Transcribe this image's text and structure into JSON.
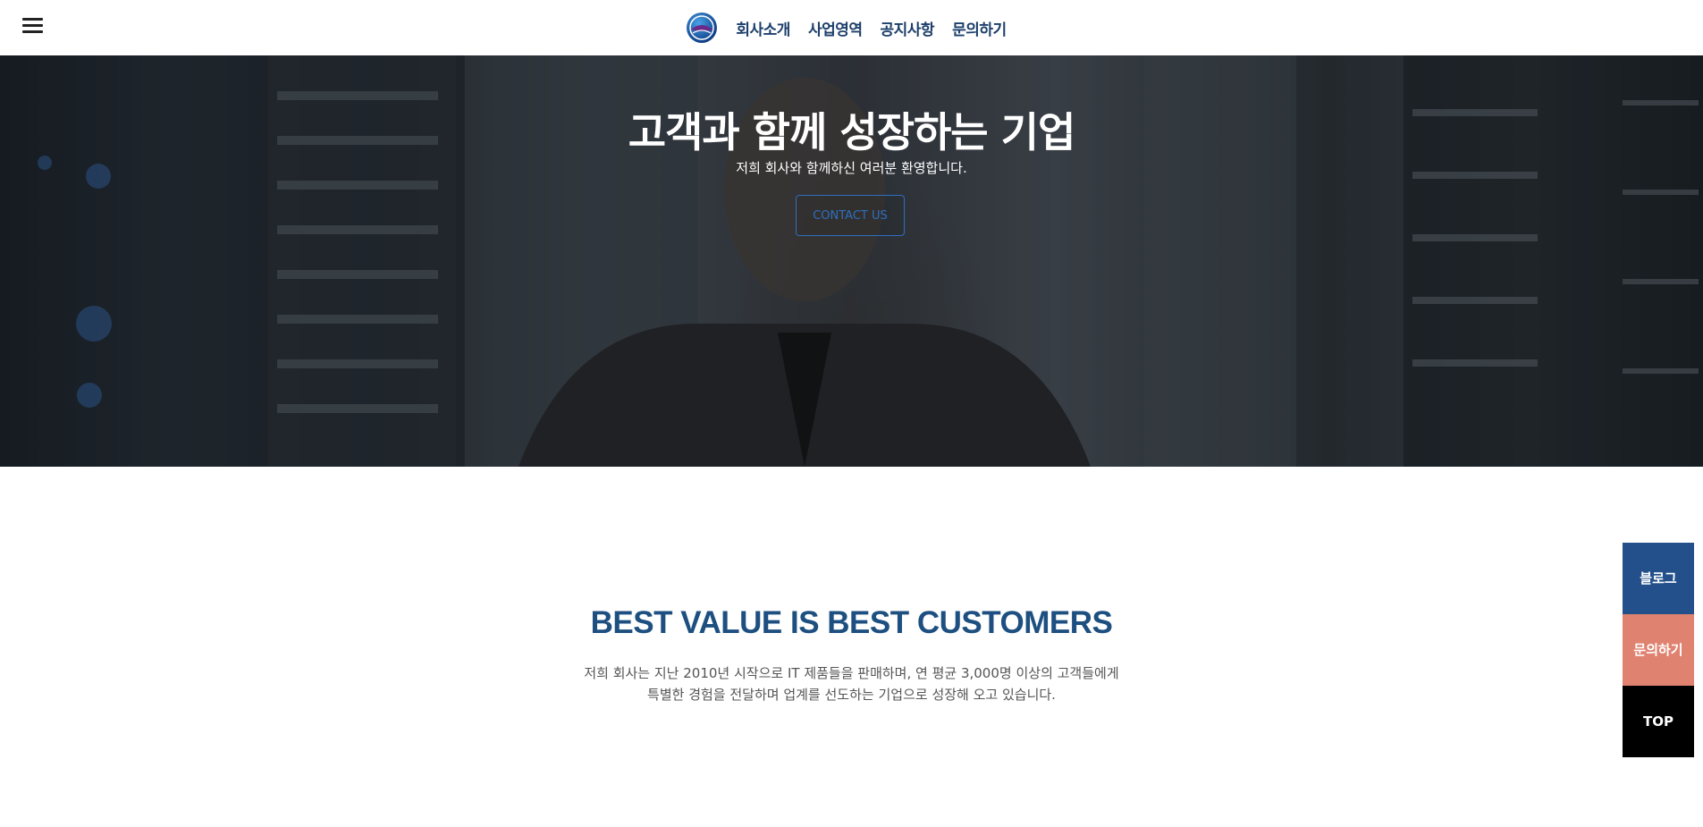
{
  "header": {
    "menu_icon": "hamburger-menu-icon",
    "logo_icon": "globe-logo-icon",
    "nav": [
      {
        "label": "회사소개"
      },
      {
        "label": "사업영역"
      },
      {
        "label": "공지사항"
      },
      {
        "label": "문의하기"
      }
    ]
  },
  "hero": {
    "title": "고객과 함께 성장하는 기업",
    "subtitle": "저희 회사와 함께하신 여러분 환영합니다.",
    "cta_label": "CONTACT US"
  },
  "intro": {
    "title": "BEST VALUE IS BEST CUSTOMERS",
    "desc_line1": "저희 회사는 지난 2010년 시작으로 IT 제품들을 판매하며, 연 평균 3,000명 이상의 고객들에게",
    "desc_line2": "특별한 경험을 전달하며 업계를 선도하는 기업으로 성장해 오고 있습니다."
  },
  "quick_menu": {
    "blog_label": "블로그",
    "contact_label": "문의하기",
    "top_label": "TOP"
  },
  "colors": {
    "nav_text": "#1d3f6b",
    "title_blue": "#1d4f80",
    "cta_border": "#2e6fbf",
    "blog_bg": "#23508a",
    "contact_bg": "#e08270",
    "top_bg": "#000000"
  }
}
